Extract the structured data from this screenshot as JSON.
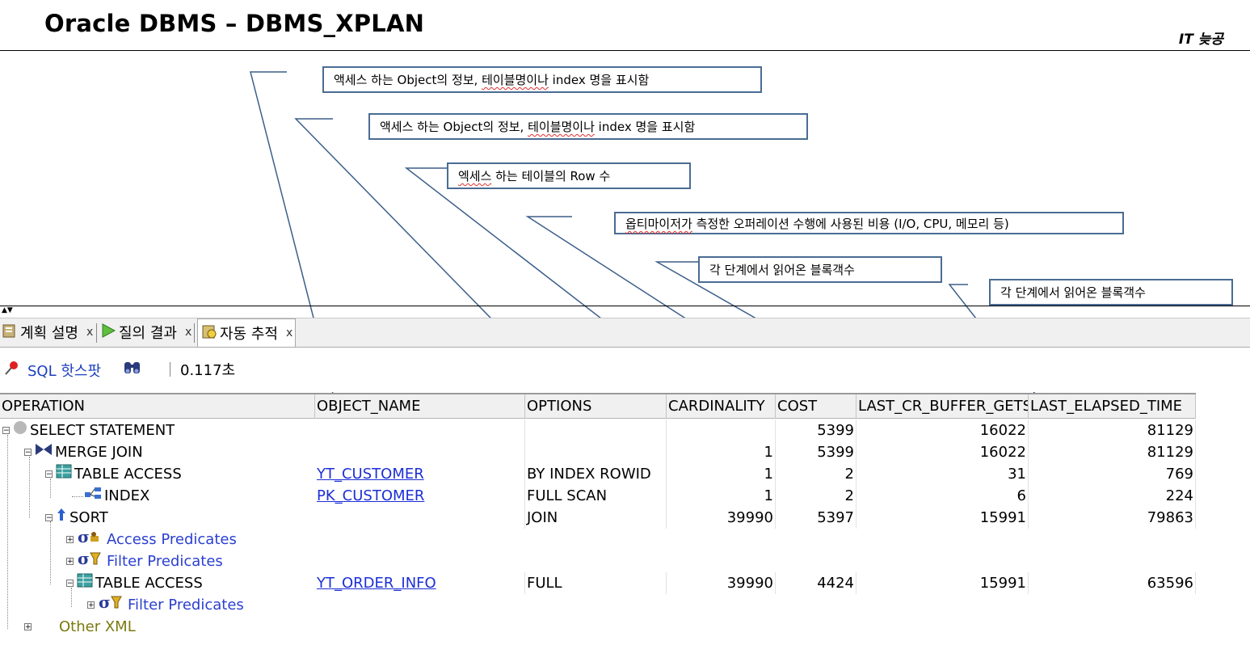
{
  "slide": {
    "title": "Oracle DBMS – DBMS_XPLAN",
    "brand": "IT 늦공"
  },
  "callouts": [
    {
      "prefix": "액세스 하는 Object의 정보, ",
      "squiggle": "테이블명이나",
      "suffix": " index 명을 표시함"
    },
    {
      "prefix": "액세스 하는 Object의 정보, ",
      "squiggle": "테이블명이나",
      "suffix": " index 명을 표시함"
    },
    {
      "prefix": "",
      "squiggle": "엑세스",
      "suffix": " 하는 테이블의 Row 수"
    },
    {
      "prefix": "",
      "squiggle": "옵티마이저가",
      "suffix": " 측정한 오퍼레이션 수행에 사용된 비용 (I/O, CPU, 메모리 등)"
    },
    {
      "prefix": "각 단계에서 읽어온 블록객수",
      "squiggle": "",
      "suffix": ""
    },
    {
      "prefix": "각 단계에서 읽어온 블록객수",
      "squiggle": "",
      "suffix": ""
    }
  ],
  "tabs": [
    {
      "label": "계획 설명",
      "close": "x"
    },
    {
      "label": "질의 결과",
      "close": "x"
    },
    {
      "label": "자동 추적",
      "close": "x"
    }
  ],
  "toolbar": {
    "sql_hotspot": "SQL 핫스팟",
    "elapsed": "0.117초"
  },
  "columns": [
    "OPERATION",
    "OBJECT_NAME",
    "OPTIONS",
    "CARDINALITY",
    "COST",
    "LAST_CR_BUFFER_GETS",
    "LAST_ELAPSED_TIME"
  ],
  "rows": [
    {
      "operation": "SELECT STATEMENT",
      "object_name": "",
      "options": "",
      "cardinality": "",
      "cost": "5399",
      "buffer_gets": "16022",
      "elapsed": "81129"
    },
    {
      "operation": "MERGE JOIN",
      "object_name": "",
      "options": "",
      "cardinality": "1",
      "cost": "5399",
      "buffer_gets": "16022",
      "elapsed": "81129"
    },
    {
      "operation": "TABLE ACCESS",
      "object_name": "YT_CUSTOMER",
      "options": "BY INDEX ROWID",
      "cardinality": "1",
      "cost": "2",
      "buffer_gets": "31",
      "elapsed": "769"
    },
    {
      "operation": "INDEX",
      "object_name": "PK_CUSTOMER",
      "options": "FULL SCAN",
      "cardinality": "1",
      "cost": "2",
      "buffer_gets": "6",
      "elapsed": "224"
    },
    {
      "operation": "SORT",
      "object_name": "",
      "options": "JOIN",
      "cardinality": "39990",
      "cost": "5397",
      "buffer_gets": "15991",
      "elapsed": "79863"
    },
    {
      "operation": "Access Predicates"
    },
    {
      "operation": "Filter Predicates"
    },
    {
      "operation": "TABLE ACCESS",
      "object_name": "YT_ORDER_INFO",
      "options": "FULL",
      "cardinality": "39990",
      "cost": "4424",
      "buffer_gets": "15991",
      "elapsed": "63596"
    },
    {
      "operation": "Filter Predicates"
    },
    {
      "operation": "Other XML"
    }
  ],
  "colors": {
    "callout_border": "#4a6c93",
    "leader_line": "#3c5f8a",
    "link": "#1c2fd6",
    "predicate_text": "#2a3fd0",
    "other_xml_text": "#7a7a10"
  },
  "icons": [
    "collapse-arrow-icon",
    "plan-icon",
    "run-icon",
    "autotrace-icon",
    "pin-icon",
    "binoculars-icon",
    "statement-icon",
    "merge-join-icon",
    "table-icon",
    "index-icon",
    "sort-icon",
    "access-predicate-icon",
    "filter-predicate-icon"
  ]
}
